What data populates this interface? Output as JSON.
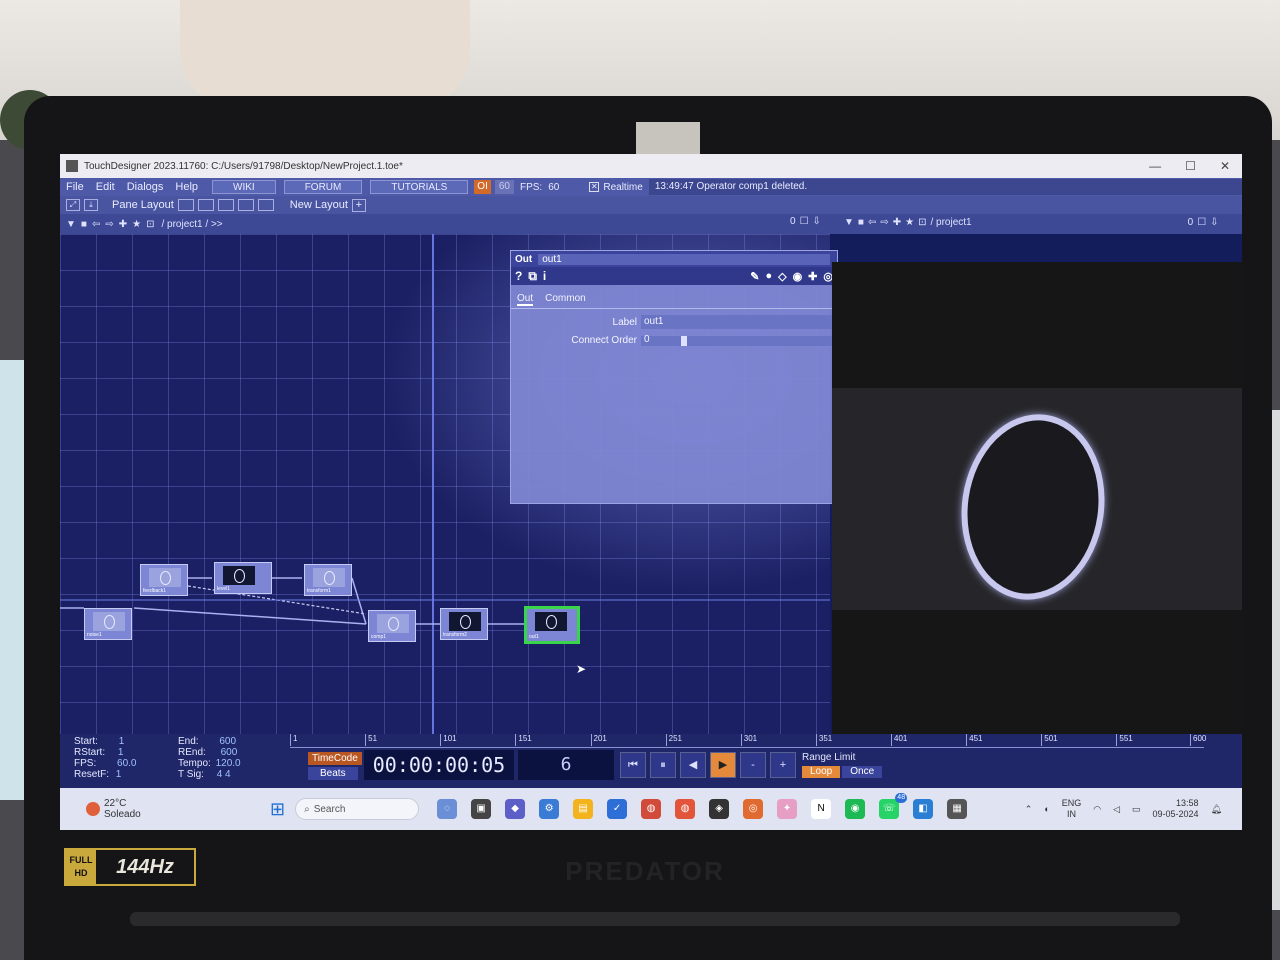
{
  "window": {
    "title": "TouchDesigner 2023.11760: C:/Users/91798/Desktop/NewProject.1.toe*",
    "controls": [
      "—",
      "☐",
      "✕"
    ]
  },
  "menubar": {
    "menus": [
      "File",
      "Edit",
      "Dialogs",
      "Help"
    ],
    "links": [
      "WIKI",
      "FORUM",
      "TUTORIALS"
    ],
    "oi": "OI",
    "fps_cap": "60",
    "fps_label": "FPS:",
    "fps_value": "60",
    "realtime_label": "Realtime",
    "status": "13:49:47 Operator comp1 deleted."
  },
  "toolbar": {
    "pane_layout": "Pane Layout",
    "new_layout": "New Layout"
  },
  "pathbar": {
    "path": "/ project1 / >>",
    "viewer_path": "/ project1",
    "pane_index_left": "0",
    "pane_index_right": "0"
  },
  "network": {
    "nodes": [
      {
        "name": "feedback1"
      },
      {
        "name": "level1"
      },
      {
        "name": "transform1"
      },
      {
        "name": "noise1"
      },
      {
        "name": "comp1"
      },
      {
        "name": "transform2"
      },
      {
        "name": "out1"
      }
    ]
  },
  "params": {
    "op_type": "Out",
    "op_name": "out1",
    "tabs": [
      "Out",
      "Common"
    ],
    "fields": [
      {
        "label": "Label",
        "value": "out1"
      },
      {
        "label": "Connect Order",
        "value": "0"
      }
    ]
  },
  "timeline": {
    "stats_left": [
      {
        "label": "Start:",
        "value": "1"
      },
      {
        "label": "RStart:",
        "value": "1"
      },
      {
        "label": "FPS:",
        "value": "60.0"
      },
      {
        "label": "ResetF:",
        "value": "1"
      }
    ],
    "stats_right": [
      {
        "label": "End:",
        "value": "600"
      },
      {
        "label": "REnd:",
        "value": "600"
      },
      {
        "label": "Tempo:",
        "value": "120.0"
      },
      {
        "label": "T Sig:",
        "value": "4    4"
      }
    ],
    "ruler_ticks": [
      "1",
      "51",
      "101",
      "151",
      "201",
      "251",
      "301",
      "351",
      "401",
      "451",
      "501",
      "551",
      "600"
    ],
    "timecode_label": "TimeCode",
    "beats_label": "Beats",
    "timecode": "00:00:00:05",
    "frame": "6",
    "buttons": [
      "⏮",
      "⏸",
      "◀",
      "▶",
      "-",
      "+"
    ],
    "range_limit": "Range Limit",
    "loop": "Loop",
    "once": "Once"
  },
  "taskbar": {
    "weather_temp": "22°C",
    "weather_desc": "Soleado",
    "search_placeholder": "Search",
    "notif_badge": "48",
    "lang_top": "ENG",
    "lang_bottom": "IN",
    "time": "13:58",
    "date": "09-05-2024"
  },
  "hardware": {
    "badge_line1": "FULL",
    "badge_line2": "HD",
    "refresh": "144Hz",
    "brand": "PREDATOR"
  }
}
